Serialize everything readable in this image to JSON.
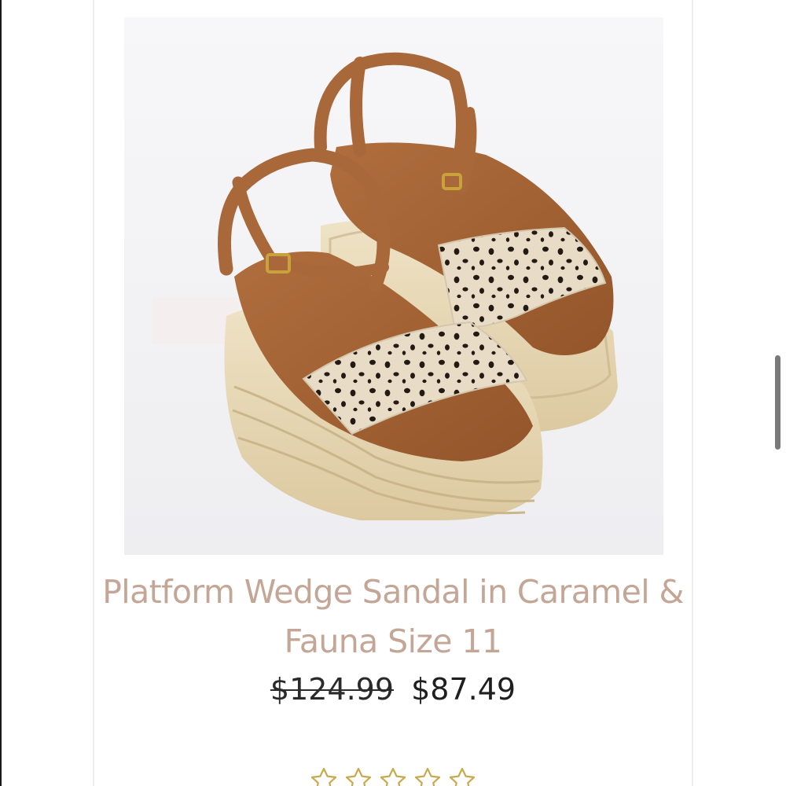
{
  "product": {
    "image_alt": "Platform Wedge Sandal in Caramel & Fauna",
    "title": "Platform Wedge Sandal in Caramel & Fauna Size 11",
    "original_price": "$124.99",
    "sale_price": "$87.49"
  },
  "rating": {
    "value": 0,
    "max": 5,
    "star_outline_color": "#c9a94e"
  },
  "colors": {
    "title": "#c4a697",
    "leather": "#a8683a",
    "jute": "#e6d6b4",
    "fauna_base": "#e9dcc6",
    "fauna_spots": "#231a14"
  }
}
